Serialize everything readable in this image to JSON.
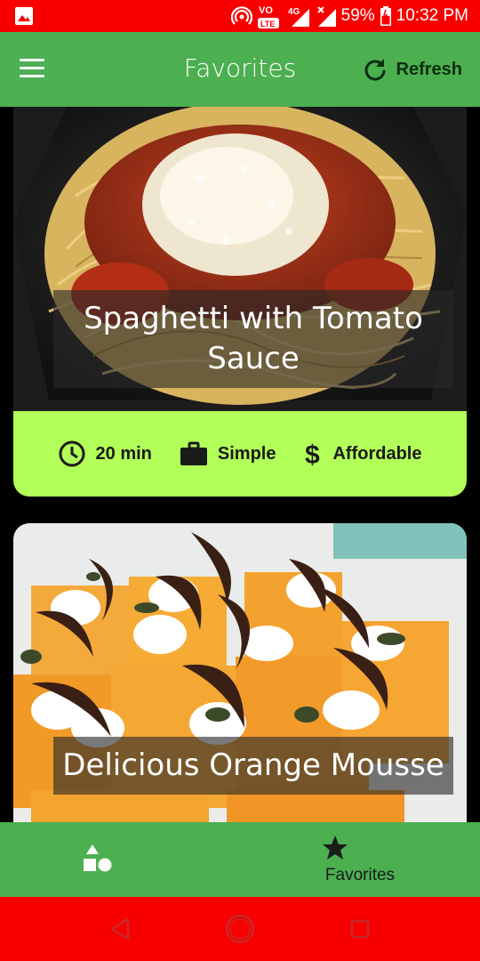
{
  "status_bar": {
    "battery": "59%",
    "time": "10:32 PM",
    "network": "4G",
    "volte": "LTE",
    "icons": [
      "image-icon",
      "hotspot-icon",
      "volte-icon",
      "signal-icon",
      "signal-x-icon",
      "battery-icon"
    ]
  },
  "app_bar": {
    "title": "Favorites",
    "refresh_label": "Refresh",
    "colors": {
      "background": "#4caf50",
      "refresh_text": "#0b2e0f"
    }
  },
  "meals": [
    {
      "title": "Spaghetti with Tomato Sauce",
      "duration": "20 min",
      "complexity": "Simple",
      "affordability": "Affordable"
    },
    {
      "title": "Delicious Orange Mousse"
    }
  ],
  "bottom_nav": {
    "items": [
      {
        "label": "",
        "icon": "categories-icon"
      },
      {
        "label": "Favorites",
        "icon": "star-icon",
        "selected": true
      }
    ]
  },
  "colors": {
    "status_bar": "#f80000",
    "accent": "#4caf50",
    "card_footer": "#b2ff59"
  }
}
